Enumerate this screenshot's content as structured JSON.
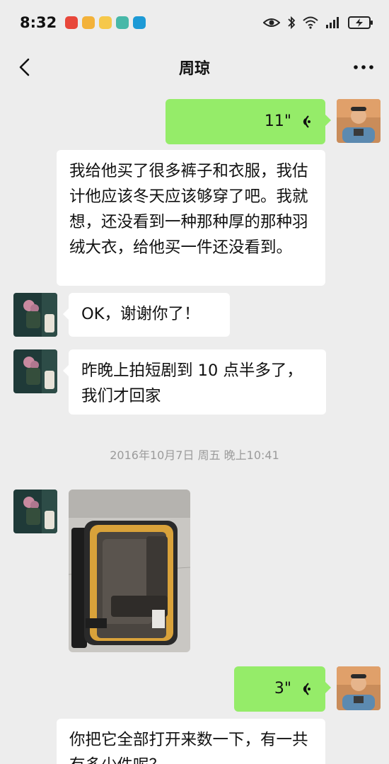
{
  "status_bar": {
    "time": "8:32"
  },
  "header": {
    "title": "周琼"
  },
  "messages": {
    "voice_1": {
      "duration": "11\""
    },
    "text_1": {
      "text": "我给他买了很多裤子和衣服，我估计他应该冬天应该够穿了吧。我就想，还没看到一种那种厚的那种羽绒大衣，给他买一件还没看到。"
    },
    "text_2": {
      "text": "OK，谢谢你了！"
    },
    "text_3": {
      "text": "昨晚上拍短剧到 10 点半多了，我们才回家"
    },
    "timestamp": "2016年10月7日 周五 晚上10:41",
    "voice_2": {
      "duration": "3\""
    },
    "text_4": {
      "text": "你把它全部打开来数一下，有一共有多少件呢？"
    }
  },
  "colors": {
    "background": "#ededed",
    "bubble_mine": "#95ec69",
    "bubble_other": "#ffffff",
    "timestamp": "#9b9b9b"
  },
  "icons": [
    "back-icon",
    "more-icon",
    "voice-icon",
    "eye-icon",
    "bluetooth-icon",
    "wifi-icon",
    "signal-icon",
    "battery-icon"
  ]
}
